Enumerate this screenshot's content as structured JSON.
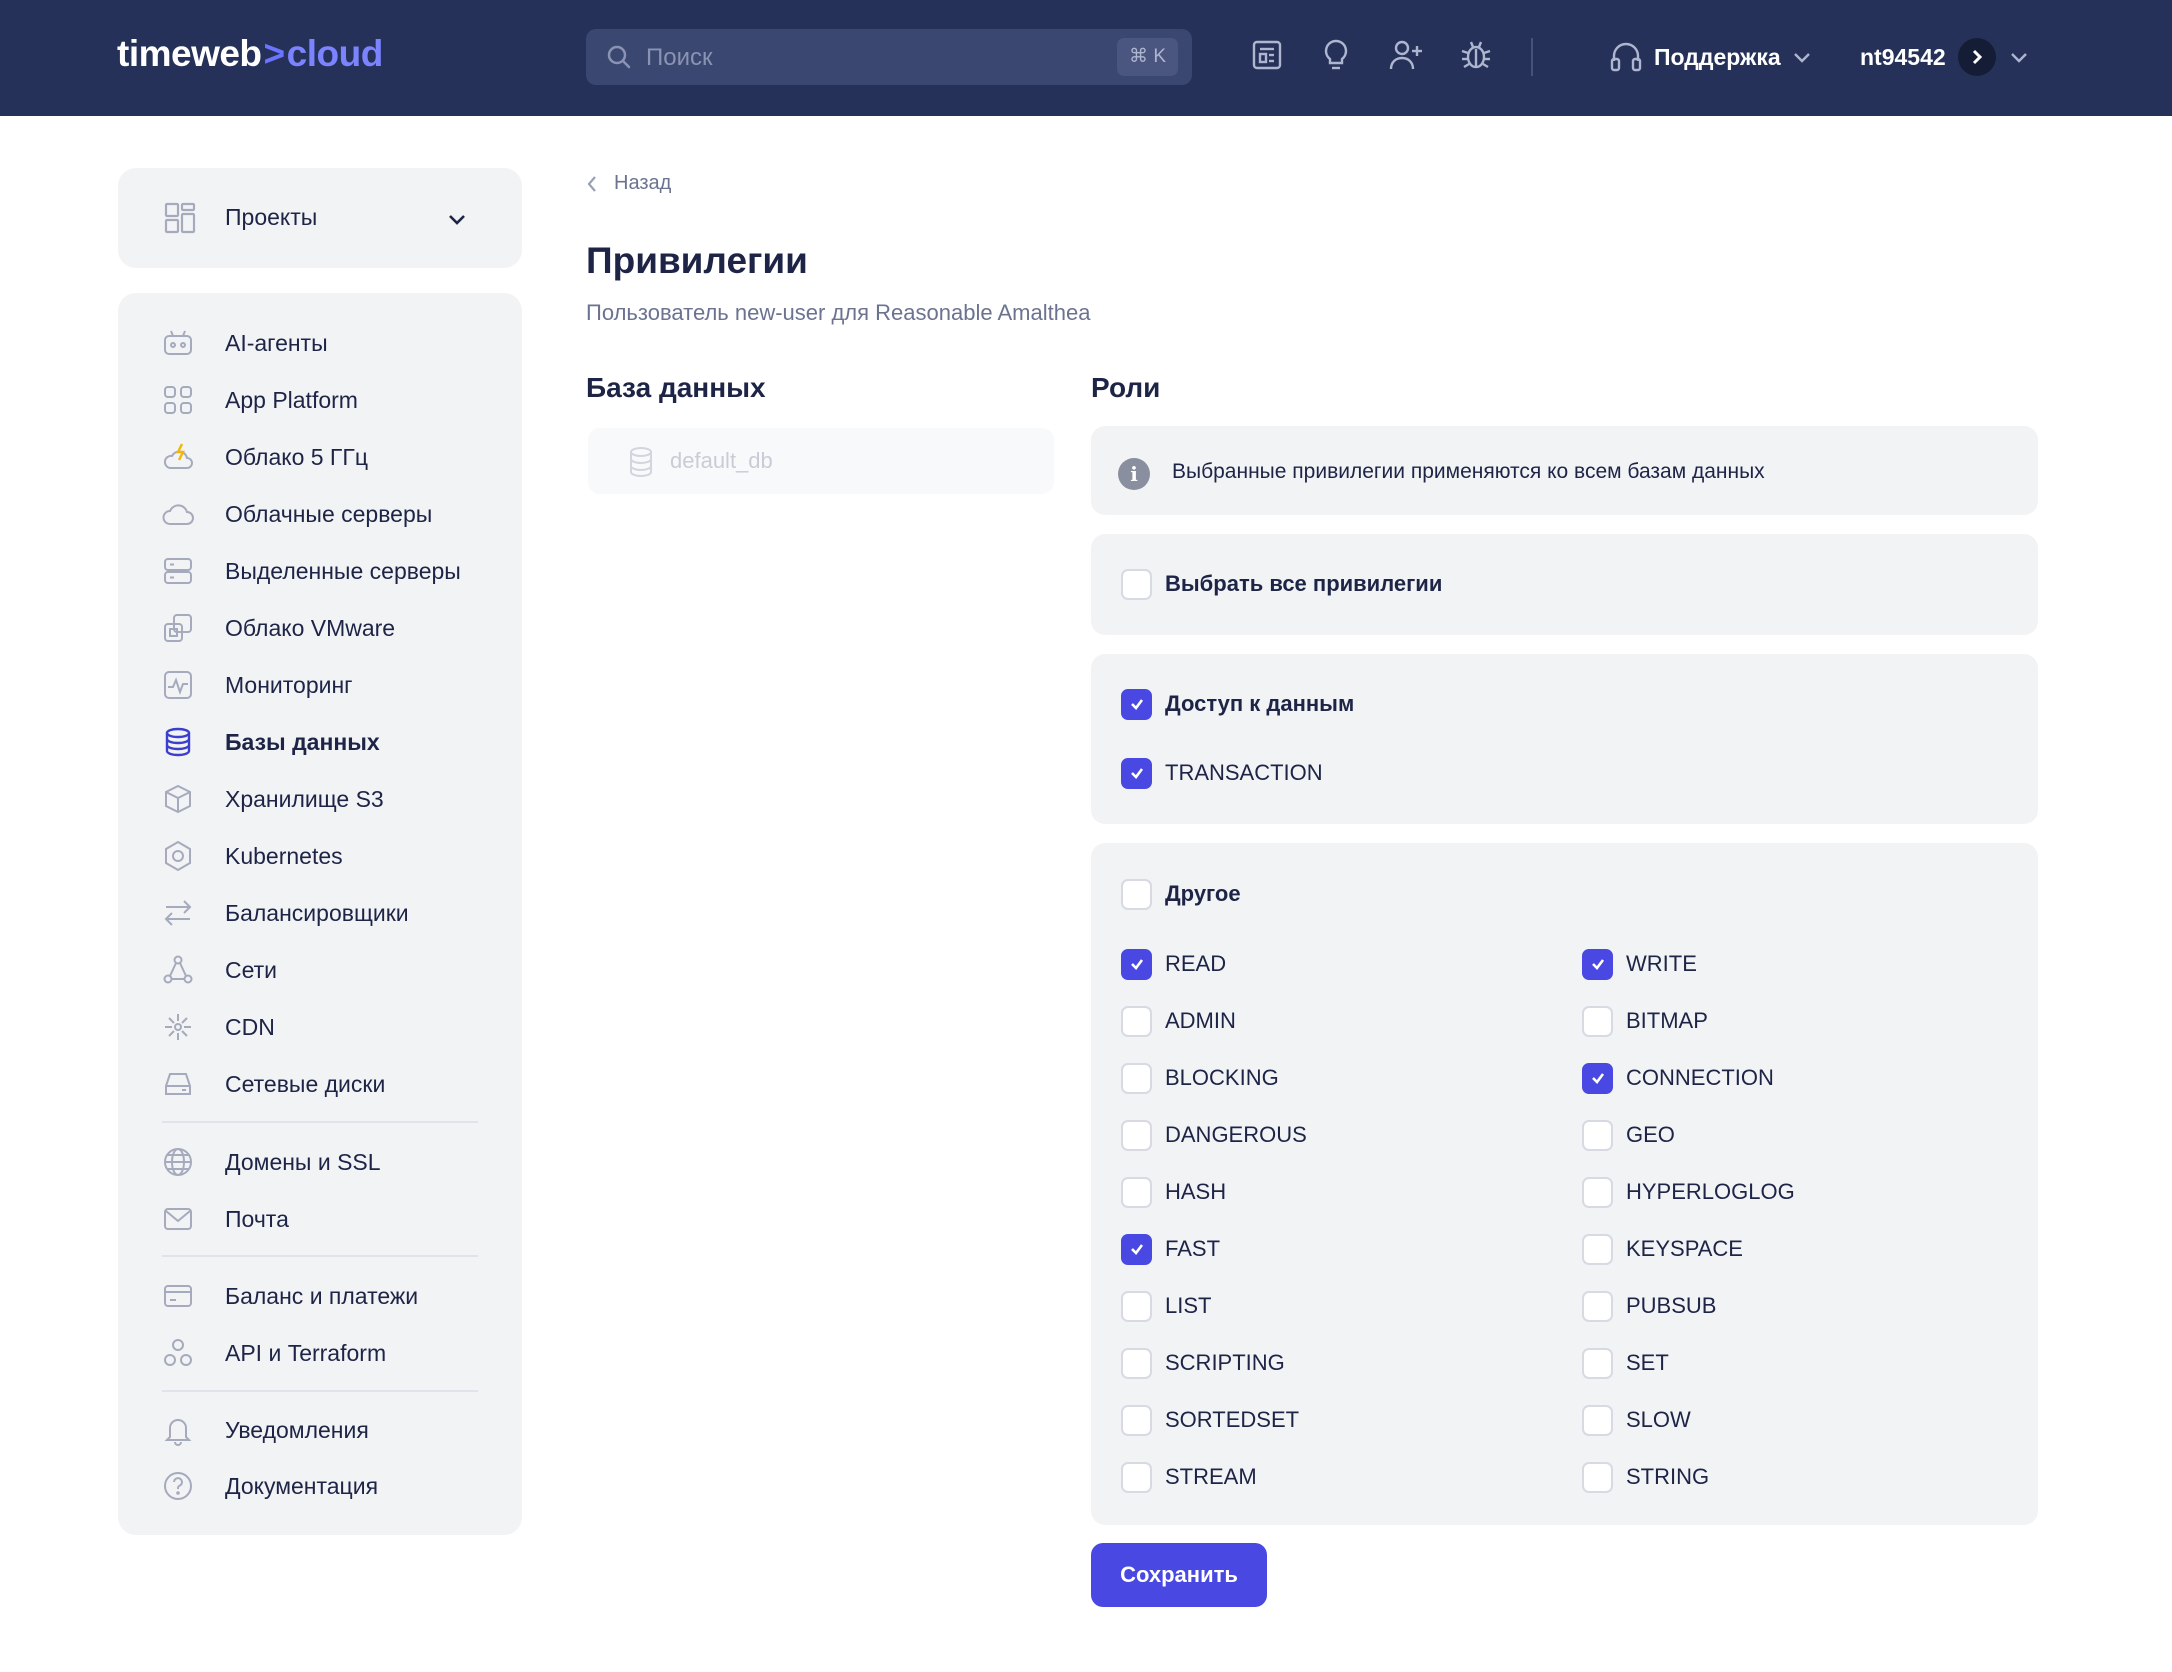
{
  "header": {
    "logo_main": "timeweb",
    "logo_arrow": ">",
    "logo_cloud": "cloud",
    "search_placeholder": "Поиск",
    "search_shortcut": "⌘ K",
    "support_label": "Поддержка",
    "username": "nt94542",
    "icons": [
      "news-icon",
      "lightbulb-icon",
      "add-user-icon",
      "bug-icon",
      "headset-icon"
    ]
  },
  "projects": {
    "label": "Проекты"
  },
  "sidebar": {
    "items": [
      {
        "label": "AI-агенты",
        "icon": "robot-icon"
      },
      {
        "label": "App Platform",
        "icon": "apps-grid-icon"
      },
      {
        "label": "Облако 5 ГГц",
        "icon": "cloud-bolt-icon"
      },
      {
        "label": "Облачные серверы",
        "icon": "cloud-icon"
      },
      {
        "label": "Выделенные серверы",
        "icon": "server-icon"
      },
      {
        "label": "Облако VMware",
        "icon": "vmware-icon"
      },
      {
        "label": "Мониторинг",
        "icon": "monitoring-icon"
      },
      {
        "label": "Базы данных",
        "icon": "database-icon",
        "active": true
      },
      {
        "label": "Хранилище S3",
        "icon": "cube-icon"
      },
      {
        "label": "Kubernetes",
        "icon": "kubernetes-icon"
      },
      {
        "label": "Балансировщики",
        "icon": "arrows-icon"
      },
      {
        "label": "Сети",
        "icon": "network-icon"
      },
      {
        "label": "CDN",
        "icon": "cdn-icon"
      },
      {
        "label": "Сетевые диски",
        "icon": "disk-icon"
      },
      {
        "label": "Домены и SSL",
        "icon": "globe-icon"
      },
      {
        "label": "Почта",
        "icon": "mail-icon"
      },
      {
        "label": "Баланс и платежи",
        "icon": "card-icon"
      },
      {
        "label": "API и Terraform",
        "icon": "api-icon"
      },
      {
        "label": "Уведомления",
        "icon": "bell-icon"
      },
      {
        "label": "Документация",
        "icon": "help-icon"
      }
    ]
  },
  "main": {
    "back_label": "Назад",
    "title": "Привилегии",
    "subtitle": "Пользователь new-user для Reasonable Amalthea",
    "db_heading": "База данных",
    "db_item": "default_db",
    "roles_heading": "Роли",
    "info_text": "Выбранные привилегии применяются ко всем базам данных",
    "select_all": {
      "label": "Выбрать все привилегии",
      "checked": false
    },
    "data_access": [
      {
        "label": "Доступ к данным",
        "checked": true
      },
      {
        "label": "TRANSACTION",
        "checked": true
      }
    ],
    "other": {
      "label": "Другое",
      "checked": false
    },
    "roles": [
      {
        "label": "READ",
        "checked": true
      },
      {
        "label": "WRITE",
        "checked": true
      },
      {
        "label": "ADMIN",
        "checked": false
      },
      {
        "label": "BITMAP",
        "checked": false
      },
      {
        "label": "BLOCKING",
        "checked": false
      },
      {
        "label": "CONNECTION",
        "checked": true
      },
      {
        "label": "DANGEROUS",
        "checked": false
      },
      {
        "label": "GEO",
        "checked": false
      },
      {
        "label": "HASH",
        "checked": false
      },
      {
        "label": "HYPERLOGLOG",
        "checked": false
      },
      {
        "label": "FAST",
        "checked": true
      },
      {
        "label": "KEYSPACE",
        "checked": false
      },
      {
        "label": "LIST",
        "checked": false
      },
      {
        "label": "PUBSUB",
        "checked": false
      },
      {
        "label": "SCRIPTING",
        "checked": false
      },
      {
        "label": "SET",
        "checked": false
      },
      {
        "label": "SORTEDSET",
        "checked": false
      },
      {
        "label": "SLOW",
        "checked": false
      },
      {
        "label": "STREAM",
        "checked": false
      },
      {
        "label": "STRING",
        "checked": false
      }
    ],
    "save_label": "Сохранить"
  },
  "colors": {
    "header_bg": "#253158",
    "accent": "#4a48e2",
    "panel_bg": "#f2f3f5"
  }
}
